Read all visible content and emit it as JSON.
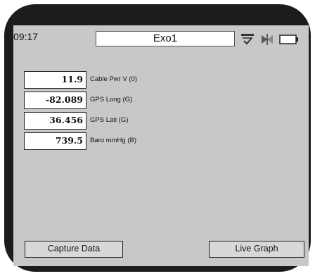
{
  "status_bar": {
    "time": "09:17",
    "title": "Exo1",
    "icons": [
      "checklist-icon",
      "wireless-icon",
      "battery-icon"
    ]
  },
  "readings": [
    {
      "value": "11.9",
      "label": "Cable Pwr V (0)"
    },
    {
      "value": "-82.089",
      "label": "GPS Long (G)"
    },
    {
      "value": "36.456",
      "label": "GPS Lati (G)"
    },
    {
      "value": "739.5",
      "label": "Baro mmHg (B)"
    }
  ],
  "buttons": {
    "capture_label": "Capture Data",
    "graph_label": "Live Graph"
  },
  "colors": {
    "screen_background": "#c8c8c8",
    "device_frame": "#1c1c1c"
  }
}
